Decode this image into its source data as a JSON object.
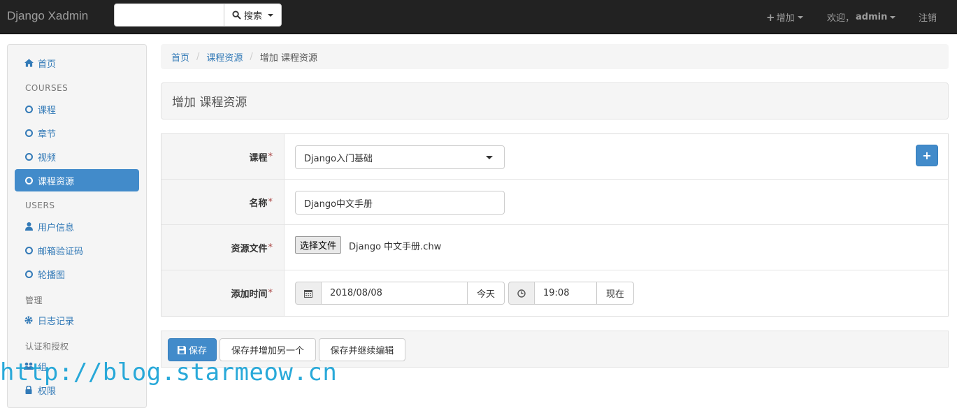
{
  "navbar": {
    "brand": "Django Xadmin",
    "search_placeholder": "",
    "search_button": "搜索",
    "add_label": "增加",
    "welcome": "欢迎，",
    "username": "admin",
    "logout": "注销"
  },
  "sidebar": {
    "home": "首页",
    "groups": [
      {
        "header": "COURSES",
        "items": [
          "课程",
          "章节",
          "视频",
          "课程资源"
        ]
      },
      {
        "header": "USERS",
        "items": [
          "用户信息",
          "邮箱验证码",
          "轮播图"
        ]
      },
      {
        "header": "管理",
        "items": [
          "日志记录"
        ]
      },
      {
        "header": "认证和授权",
        "items": [
          "组",
          "权限"
        ]
      }
    ],
    "active_item": "课程资源"
  },
  "breadcrumb": [
    "首页",
    "课程资源",
    "增加 课程资源"
  ],
  "page_title": "增加 课程资源",
  "form": {
    "course_label": "课程",
    "course_value": "Django入门基础",
    "name_label": "名称",
    "name_value": "Django中文手册",
    "file_label": "资源文件",
    "file_button": "选择文件",
    "file_name": "Django 中文手册.chw",
    "time_label": "添加时间",
    "date_value": "2018/08/08",
    "today_button": "今天",
    "time_value": "19:08",
    "now_button": "现在",
    "required_mark": "*"
  },
  "actions": {
    "save": "保存",
    "save_add": "保存并增加另一个",
    "save_continue": "保存并继续编辑"
  },
  "watermark": "http://blog.starmeow.cn",
  "colors": {
    "navbar_bg": "#222222",
    "primary": "#428bca",
    "link": "#337ab7"
  }
}
